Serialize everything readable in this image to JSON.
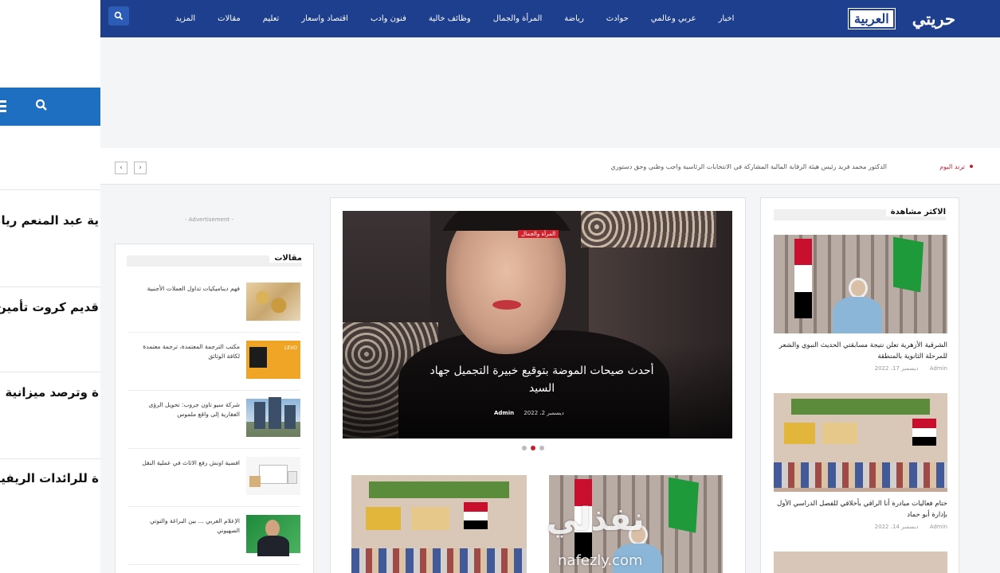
{
  "left_panel": {
    "titles": [
      "ية عبد المنعم رياض",
      "قديم كروت تأمين",
      "ة وترصد ميزانية",
      "ة للرائدات الريفيات"
    ]
  },
  "nav": {
    "logo_part1": "حريتي",
    "logo_part2": "العربية",
    "items": [
      "اخبار",
      "عربي وعالمي",
      "حوادث",
      "رياضة",
      "المرأة والجمال",
      "وظائف خالية",
      "فنون وادب",
      "اقتصاد واسعار",
      "تعليم",
      "مقالات",
      "المزيد"
    ]
  },
  "ticker": {
    "label": "ترند اليوم",
    "text": "الدكتور محمد فريد رئيس هيئة الرقابة المالية المشاركة في الانتخابات الرئاسية واجب وطني وحق دستوري",
    "prev_arrow": "‹",
    "next_arrow": "›"
  },
  "advertisement_label": "- Advertisement -",
  "articles_widget": {
    "title": "مقالات",
    "items": [
      {
        "title": "فهم ديناميكيات تداول العملات الأجنبية",
        "image": "coins"
      },
      {
        "title": "مكتب الترجمة المعتمدة، ترجمة معتمدة لكافة الوثائق",
        "image": "translate"
      },
      {
        "title": "شركة سيو تاون جروب: تحويل الرؤى العقارية إلى واقع ملموس",
        "image": "tower"
      },
      {
        "title": "افضية اونش رفع الاثاث في عملية النقل",
        "image": "truck"
      },
      {
        "title": "الإعلام العربي ... بين البراغة والتوتي الصهيوني",
        "image": "person"
      }
    ]
  },
  "hero": {
    "category": "المرأة والجمال",
    "title": "أحدث صيحات الموضة بتوقيع خبيرة التجميل جهاد السيد",
    "author": "Admin",
    "date": "ديسمبر 2، 2022",
    "slides": 3,
    "active_slide": 1
  },
  "most_viewed": {
    "title": "الاكثر مشاهدة",
    "items": [
      {
        "title": "الشرقية الأزهرية تعلن نتيجة مسابقتي الحديث النبوي والشعر للمرحلة الثانوية بالمنطقة",
        "author": "Admin",
        "date": "ديسمبر 17، 2022"
      },
      {
        "title": "ختام فعاليات مبادرة أنا الراقي بأخلاقي للفصل الدراسي الأول بإدارة أبو حماد",
        "author": "Admin",
        "date": "ديسمبر 14، 2022"
      }
    ]
  },
  "watermark": {
    "text": "نفذلي",
    "sub": "nafezly.com"
  },
  "colors": {
    "nav_bg": "#1d3f8e",
    "accent_red": "#c41f2f",
    "left_search_blue": "#1e6fc2"
  }
}
